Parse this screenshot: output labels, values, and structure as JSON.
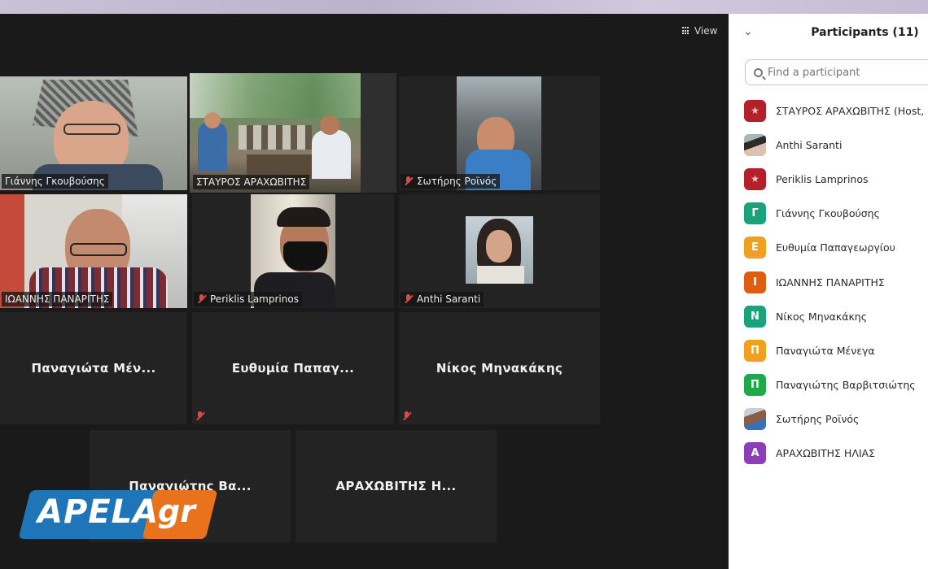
{
  "view_button": {
    "label": "View",
    "icon": "grid-icon"
  },
  "tiles": [
    {
      "name": "Γιάννης Γκουβούσης",
      "muted": false,
      "video": true
    },
    {
      "name": "ΣΤΑΥΡΟΣ ΑΡΑΧΩΒΙΤΗΣ",
      "muted": false,
      "video": true,
      "active_speaker": true
    },
    {
      "name": "Σωτήρης Ροϊνός",
      "muted": true,
      "video": true
    },
    {
      "name": "ΙΩΑΝΝΗΣ ΠΑΝΑΡΙΤΗΣ",
      "muted": false,
      "video": true
    },
    {
      "name": "Periklis Lamprinos",
      "muted": true,
      "video": true
    },
    {
      "name": "Anthi Saranti",
      "muted": true,
      "video": true
    },
    {
      "name": "Παναγιώτα Μέν...",
      "muted": false,
      "video": false
    },
    {
      "name": "Ευθυμία Παπαγ...",
      "muted": true,
      "video": false
    },
    {
      "name": "Νίκος Μηνακάκης",
      "muted": true,
      "video": false
    },
    {
      "name": "Παναγιώτης Βα...",
      "muted": true,
      "video": false
    },
    {
      "name": "ΑΡΑΧΩΒΙΤΗΣ Η...",
      "muted": false,
      "video": false
    }
  ],
  "watermark": {
    "part1": "APELA",
    "part2": "gr"
  },
  "panel": {
    "title": "Participants (11)",
    "search_placeholder": "Find a participant",
    "participants": [
      {
        "name": "ΣΤΑΥΡΟΣ ΑΡΑΧΩΒΙΤΗΣ (Host, m",
        "avatar": "logo"
      },
      {
        "name": "Anthi Saranti",
        "avatar": "photo"
      },
      {
        "name": "Periklis Lamprinos",
        "avatar": "logo"
      },
      {
        "name": "Γιάννης Γκουβούσης",
        "initial": "Γ",
        "color": "#1aa37a"
      },
      {
        "name": "Ευθυμία Παπαγεωργίου",
        "initial": "Ε",
        "color": "#f0a020"
      },
      {
        "name": "ΙΩΑΝΝΗΣ ΠΑΝΑΡΙΤΗΣ",
        "initial": "Ι",
        "color": "#e05c10"
      },
      {
        "name": "Νίκος Μηνακάκης",
        "initial": "Ν",
        "color": "#1aa37a"
      },
      {
        "name": "Παναγιώτα Μένεγα",
        "initial": "Π",
        "color": "#f0a020"
      },
      {
        "name": "Παναγιώτης Βαρβιτσιώτης",
        "initial": "Π",
        "color": "#20a84a"
      },
      {
        "name": "Σωτήρης Ροϊνός",
        "avatar": "photo"
      },
      {
        "name": "ΑΡΑΧΩΒΙΤΗΣ ΗΛΙΑΣ",
        "initial": "Α",
        "color": "#8a3fb8"
      }
    ]
  }
}
